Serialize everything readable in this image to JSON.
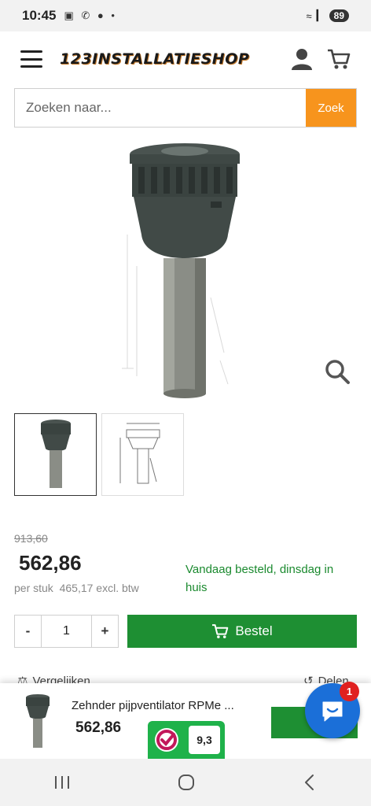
{
  "status_bar": {
    "time": "10:45",
    "battery": "89"
  },
  "header": {
    "logo": "123INSTALLATIESHOP"
  },
  "search": {
    "placeholder": "Zoeken naar...",
    "button": "Zoek"
  },
  "product": {
    "old_price": "913,60",
    "price": "562,86",
    "unit_label": "per stuk",
    "excl_vat": "465,17 excl. btw",
    "delivery": "Vandaag besteld, dinsdag in huis",
    "quantity": "1",
    "minus": "-",
    "plus": "+",
    "order_label": "Bestel",
    "compare_label": "Vergelijken",
    "share_label": "Delen"
  },
  "sticky": {
    "name": "Zehnder pijpventilator RPMe ...",
    "price": "562,86"
  },
  "kiyoh": {
    "score": "9,3"
  },
  "chat": {
    "badge": "1"
  },
  "colors": {
    "accent_orange": "#f7941d",
    "order_green": "#1e8f33",
    "delivery_green": "#1b8a2f",
    "chat_blue": "#1b6fd8"
  }
}
